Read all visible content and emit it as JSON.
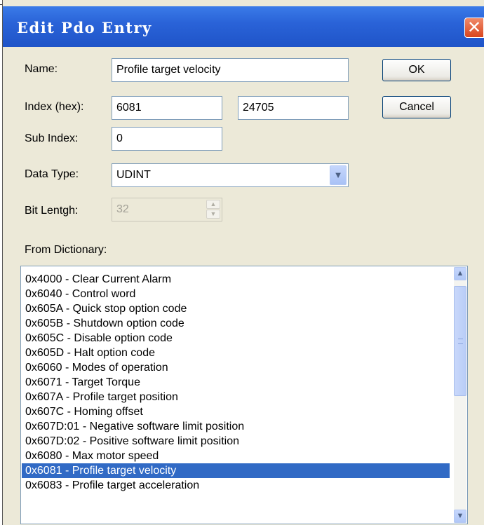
{
  "window": {
    "title": "Edit Pdo Entry",
    "close_glyph": "✕"
  },
  "form": {
    "name_label": "Name:",
    "name_value": "Profile target velocity",
    "index_label": "Index (hex):",
    "index_hex": "6081",
    "index_dec": "24705",
    "subindex_label": "Sub Index:",
    "subindex_value": "0",
    "datatype_label": "Data Type:",
    "datatype_value": "UDINT",
    "bitlength_label": "Bit Lentgh:",
    "bitlength_value": "32",
    "dictionary_label": "From Dictionary:"
  },
  "buttons": {
    "ok": "OK",
    "cancel": "Cancel"
  },
  "dictionary": {
    "items": [
      "0x4000 - Clear Current Alarm",
      "0x6040 - Control word",
      "0x605A - Quick stop option code",
      "0x605B - Shutdown option code",
      "0x605C - Disable option code",
      "0x605D - Halt option code",
      "0x6060 - Modes of operation",
      "0x6071 - Target Torque",
      "0x607A - Profile target position",
      "0x607C - Homing offset",
      "0x607D:01 - Negative software limit position",
      "0x607D:02 - Positive software limit position",
      "0x6080 - Max motor speed",
      "0x6081 - Profile target velocity",
      "0x6083 - Profile target acceleration"
    ],
    "selected_index": 13
  },
  "colors": {
    "titlebar": "#2a63d8",
    "selection": "#316ac5",
    "dialog_bg": "#ece9d8"
  }
}
